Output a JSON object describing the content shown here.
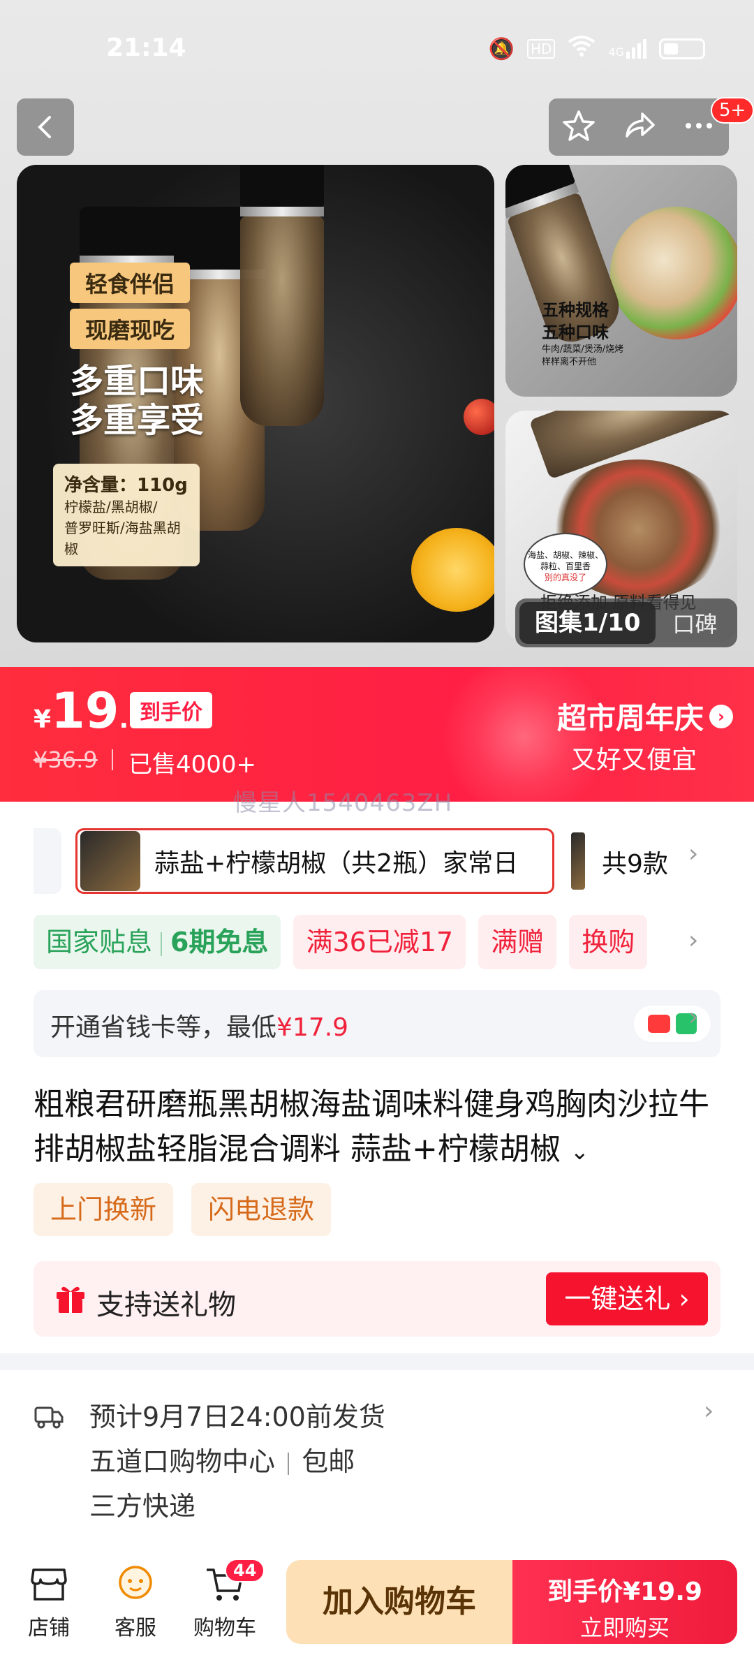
{
  "status_bar": {
    "time": "21:14",
    "icons": [
      "mute-icon",
      "hd-icon",
      "wifi-icon",
      "4g-signal-icon",
      "battery-icon"
    ],
    "hd": "HD",
    "network": "4G"
  },
  "header": {
    "message_badge": "5+"
  },
  "gallery": {
    "main": {
      "tag1": "轻食伴侣",
      "tag2": "现磨现吃",
      "slogan1": "多重口味",
      "slogan2": "多重享受",
      "net_weight": "净含量：110g",
      "flavors1": "柠檬盐/黑胡椒/",
      "flavors2": "普罗旺斯/海盐黑胡椒"
    },
    "side1": {
      "line1": "五种规格",
      "line2": "五种口味",
      "line3": "牛肉/蔬菜/煲汤/烧烤",
      "line4": "样样离不开他"
    },
    "side2": {
      "bubble": "海盐、胡椒、辣椒、蒜粒、百里香",
      "bubble_note": "别的真没了",
      "caption": "拒绝添加 原料看得见"
    },
    "album_label": "图集1/10",
    "reviews_label": "口碑"
  },
  "price_banner": {
    "currency": "¥",
    "price_int": "19",
    "price_dec": ".9",
    "price_tag": "到手价",
    "original_price": "¥36.9",
    "sold": "已售4000+",
    "promo_title": "超市周年庆",
    "promo_sub": "又好又便宜",
    "watermark": "慢星人1540463ZH"
  },
  "sku": {
    "selected": "蒜盐+柠檬胡椒（共2瓶）家常日",
    "total": "共9款"
  },
  "promotions": {
    "national_subsidy": "国家贴息",
    "installment": "6期免息",
    "discount": "满36已减17",
    "gift": "满赠",
    "exchange": "换购"
  },
  "saver": {
    "text_prefix": "开通省钱卡等，最低",
    "lowest_price": "¥17.9"
  },
  "product": {
    "title": "粗粮君研磨瓶黑胡椒海盐调味料健身鸡胸肉沙拉牛排胡椒盐轻脂混合调料 蒜盐+柠檬胡椒",
    "service_tags": [
      "上门换新",
      "闪电退款"
    ]
  },
  "gift": {
    "label": "支持送礼物",
    "button": "一键送礼"
  },
  "shipping": {
    "estimate": "预计9月7日24:00前发货",
    "origin": "五道口购物中心",
    "free_shipping": "包邮",
    "carrier": "三方快递"
  },
  "bottom_bar": {
    "store": "店铺",
    "service": "客服",
    "cart": "购物车",
    "cart_count": "44",
    "add_to_cart": "加入购物车",
    "buy_price_label": "到手价¥19.9",
    "buy_now": "立即购买"
  },
  "colors": {
    "brand_red": "#f5132e",
    "cart_bg": "#fde0b5",
    "green": "#2aa35a"
  }
}
